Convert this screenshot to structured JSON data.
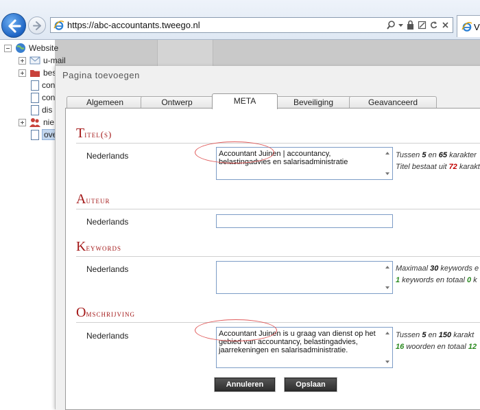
{
  "browser": {
    "url": "https://abc-accountants.tweego.nl",
    "tab_label": "V"
  },
  "tree": {
    "root": "Website",
    "items": [
      "u-mail",
      "bes",
      "con",
      "con",
      "dis",
      "nie",
      "ove"
    ]
  },
  "dialog": {
    "title": "Pagina toevoegen",
    "tabs": [
      "Algemeen",
      "Ontwerp",
      "META",
      "Beveiliging",
      "Geavanceerd"
    ],
    "active_tab": "META"
  },
  "sections": {
    "titel": {
      "cap": "T",
      "rest": "itel(s)",
      "language": "Nederlands",
      "value": "Accountant Juinen | accountancy, belastingadvies en salarisadministratie",
      "hint1": {
        "pre": "Tussen ",
        "n1": "5",
        "mid": " en ",
        "n2": "65",
        "post": " karakter"
      },
      "hint2": {
        "pre": "Titel bestaat uit ",
        "n1": "72",
        "post": " karakt"
      }
    },
    "auteur": {
      "cap": "A",
      "rest": "uteur",
      "language": "Nederlands",
      "value": ""
    },
    "keywords": {
      "cap": "K",
      "rest": "eywords",
      "language": "Nederlands",
      "value": "",
      "hint1": {
        "pre": "Maximaal ",
        "n1": "30",
        "post": " keywords e"
      },
      "hint2": {
        "n1": "1",
        "mid": " keywords en totaal ",
        "n2": "0",
        "post": " k"
      }
    },
    "omschrijving": {
      "cap": "O",
      "rest": "mschrijving",
      "language": "Nederlands",
      "value": "Accountant Juinen is u graag van dienst op het gebied van accountancy, belastingadvies, jaarrekeningen en salarisadministratie.",
      "hint1": {
        "pre": "Tussen ",
        "n1": "5",
        "mid": " en ",
        "n2": "150",
        "post": " karakt"
      },
      "hint2": {
        "n1": "16",
        "mid": " woorden en totaal ",
        "n2": "12"
      }
    }
  },
  "buttons": {
    "cancel": "Annuleren",
    "save": "Opslaan"
  },
  "colors": {
    "section_title": "#a31717",
    "hint_red": "#c00000",
    "hint_green": "#2a8a1f",
    "annotation": "#e05a5a"
  }
}
